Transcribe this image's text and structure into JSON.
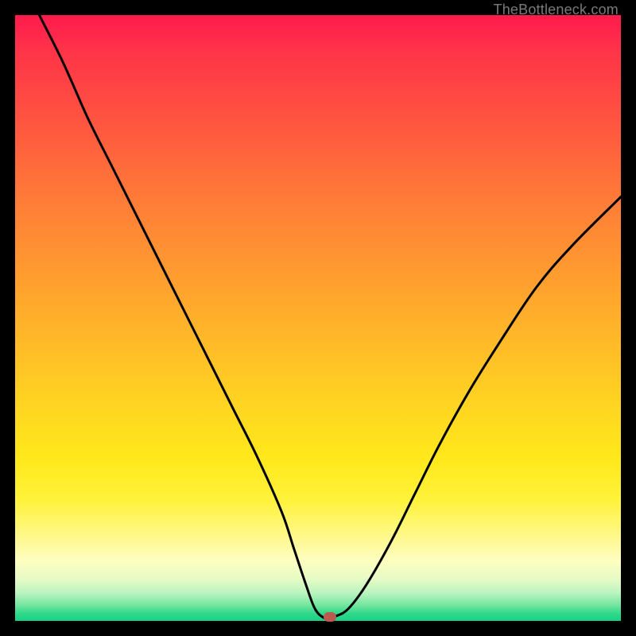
{
  "watermark": "TheBottleneck.com",
  "chart_data": {
    "type": "line",
    "title": "",
    "xlabel": "",
    "ylabel": "",
    "xlim": [
      0,
      100
    ],
    "ylim": [
      0,
      100
    ],
    "grid": false,
    "legend": false,
    "background_gradient": {
      "axis": "y",
      "stops": [
        {
          "pos": 0,
          "color": "#18d184"
        },
        {
          "pos": 4,
          "color": "#6fe59d"
        },
        {
          "pos": 8,
          "color": "#e8fbc6"
        },
        {
          "pos": 14,
          "color": "#fff88a"
        },
        {
          "pos": 24,
          "color": "#ffe81b"
        },
        {
          "pos": 40,
          "color": "#ffba28"
        },
        {
          "pos": 60,
          "color": "#ff7a38"
        },
        {
          "pos": 85,
          "color": "#ff3448"
        },
        {
          "pos": 100,
          "color": "#ff1a4d"
        }
      ]
    },
    "series": [
      {
        "name": "bottleneck-curve",
        "color": "#000000",
        "x": [
          4,
          8,
          12,
          16,
          20,
          24,
          28,
          32,
          36,
          40,
          44,
          46,
          48,
          49.5,
          51,
          52,
          53,
          55,
          58,
          62,
          66,
          70,
          75,
          80,
          86,
          92,
          100
        ],
        "y": [
          100,
          92,
          83,
          75,
          67,
          59,
          51,
          43,
          35,
          27,
          18,
          12,
          6,
          2,
          0.5,
          0.5,
          0.8,
          2,
          6,
          13,
          21,
          29,
          38,
          46,
          55,
          62,
          70
        ]
      }
    ],
    "marker": {
      "name": "optimal-point",
      "x": 52,
      "y": 0.6,
      "color": "#bc5a50"
    }
  }
}
